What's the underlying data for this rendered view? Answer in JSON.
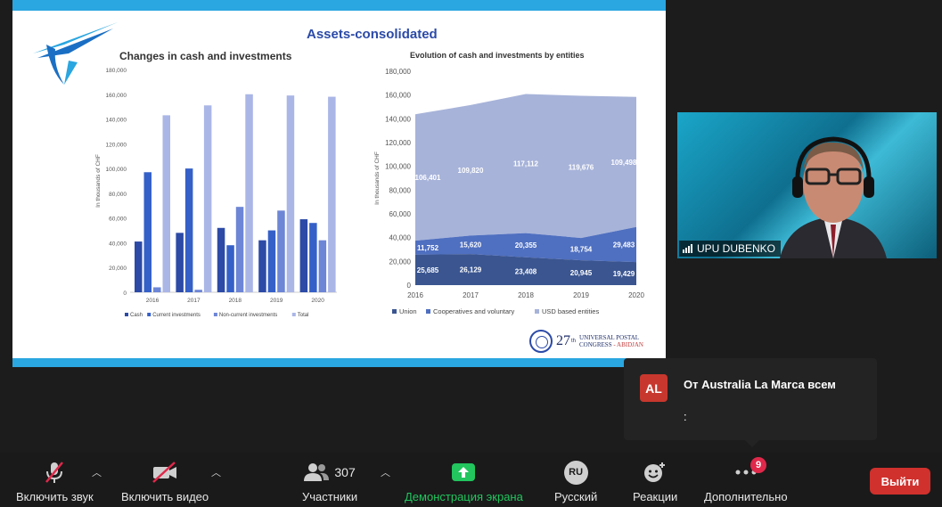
{
  "slide": {
    "title": "Assets-consolidated",
    "left_chart_title": "Changes in cash and investments",
    "right_chart_title": "Evolution of cash and investments by entities",
    "footer": {
      "number": "27",
      "th": "th",
      "line1": "UNIVERSAL POSTAL",
      "line2": "CONGRESS",
      "city": "- ABIDJAN"
    }
  },
  "chart_data": [
    {
      "type": "bar",
      "title": "Changes in cash and investments",
      "ylabel": "In thousands of CHF",
      "categories": [
        "2016",
        "2017",
        "2018",
        "2019",
        "2020"
      ],
      "ylim": [
        0,
        180000
      ],
      "yticks": [
        "180,000",
        "160,000",
        "140,000",
        "120,000",
        "100,000",
        "80,000",
        "60,000",
        "40,000",
        "20,000",
        "0"
      ],
      "series": [
        {
          "name": "Cash",
          "values": [
            41000,
            48000,
            52000,
            42000,
            59000
          ],
          "color": "#2c4aa6"
        },
        {
          "name": "Current investments",
          "values": [
            97000,
            100000,
            38000,
            50000,
            56000
          ],
          "color": "#3560c8"
        },
        {
          "name": "Non-current investments",
          "values": [
            4000,
            2000,
            69000,
            66000,
            42000
          ],
          "color": "#6d86d6"
        },
        {
          "name": "Total",
          "values": [
            143000,
            151000,
            160000,
            159000,
            158000
          ],
          "color": "#aab6e6"
        }
      ],
      "grid": false,
      "legend": "bottom"
    },
    {
      "type": "area",
      "title": "Evolution of cash and investments by entities",
      "ylabel": "In thousands of CHF",
      "x": [
        "2016",
        "2017",
        "2018",
        "2019",
        "2020"
      ],
      "ylim": [
        0,
        180000
      ],
      "yticks": [
        "180,000",
        "160,000",
        "140,000",
        "120,000",
        "100,000",
        "80,000",
        "60,000",
        "40,000",
        "20,000",
        "0"
      ],
      "series": [
        {
          "name": "Union",
          "values": [
            25685,
            26129,
            23408,
            20945,
            19429
          ],
          "labels": [
            "25,685",
            "26,129",
            "23,408",
            "20,945",
            "19,429"
          ],
          "color": "#3a5590"
        },
        {
          "name": "Cooperatives and voluntary",
          "values": [
            11752,
            15620,
            20355,
            18754,
            29483
          ],
          "labels": [
            "11,752",
            "15,620",
            "20,355",
            "18,754",
            "29,483"
          ],
          "color": "#4f6fc0"
        },
        {
          "name": "USD based entities",
          "values": [
            106401,
            109820,
            117112,
            119676,
            109498
          ],
          "labels": [
            "106,401",
            "109,820",
            "117,112",
            "119,676",
            "109,498"
          ],
          "color": "#a7b3d9"
        }
      ],
      "grid": false,
      "legend": "bottom"
    }
  ],
  "participant": {
    "name": "UPU DUBENKO"
  },
  "chat": {
    "avatar": "AL",
    "sender": "От Australia La Marca всем",
    "message": ":"
  },
  "toolbar": {
    "mute_label": "Включить звук",
    "video_label": "Включить видео",
    "participants_label": "Участники",
    "participants_count": "307",
    "share_label": "Демонстрация экрана",
    "lang_label": "Русский",
    "lang_code": "RU",
    "reactions_label": "Реакции",
    "more_label": "Дополнительно",
    "more_badge": "9",
    "leave_label": "Выйти"
  },
  "colors": {
    "share_green": "#22c55e",
    "leave_red": "#d0312d",
    "accent_blue": "#2aa6e0",
    "badge": "#e0284a"
  }
}
